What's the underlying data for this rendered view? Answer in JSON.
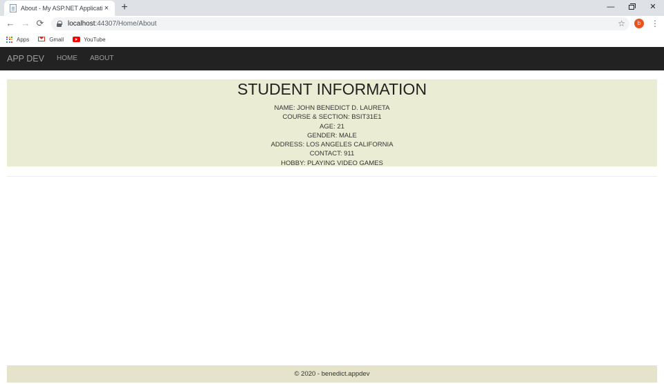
{
  "browser": {
    "tab": {
      "title": "About - My ASP.NET Application",
      "close": "×"
    },
    "new_tab": "+",
    "window": {
      "minimize": "—",
      "close": "✕"
    },
    "nav": {
      "back": "←",
      "forward": "→",
      "reload": "⟳"
    },
    "url": {
      "host": "localhost",
      "path": ":44307/Home/About"
    },
    "star": "☆",
    "profile_initial": "b",
    "menu": "⋮",
    "bookmarks": [
      {
        "label": "Apps",
        "icon": "apps-icon"
      },
      {
        "label": "Gmail",
        "icon": "gmail-icon"
      },
      {
        "label": "YouTube",
        "icon": "youtube-icon"
      }
    ],
    "apps_colors": [
      "#ea4335",
      "#fbbc05",
      "#34a853",
      "#4285f4",
      "#ea4335",
      "#fbbc05",
      "#34a853",
      "#4285f4",
      "#ea4335"
    ]
  },
  "navbar": {
    "brand": "APP DEV",
    "links": [
      "HOME",
      "ABOUT"
    ]
  },
  "student": {
    "title": "STUDENT INFORMATION",
    "lines": [
      "NAME: JOHN BENEDICT D. LAURETA",
      "COURSE & SECTION: BSIT31E1",
      "AGE: 21",
      "GENDER: MALE",
      "ADDRESS: LOS ANGELES CALIFORNIA",
      "CONTACT: 911",
      "HOBBY: PLAYING VIDEO GAMES"
    ]
  },
  "footer": {
    "text": "© 2020 - benedict.appdev"
  },
  "colors": {
    "navbar_bg": "#222222",
    "panel_bg": "#eaedd3",
    "footer_bg": "#e5e3c9",
    "profile_bg": "#e8531f"
  }
}
